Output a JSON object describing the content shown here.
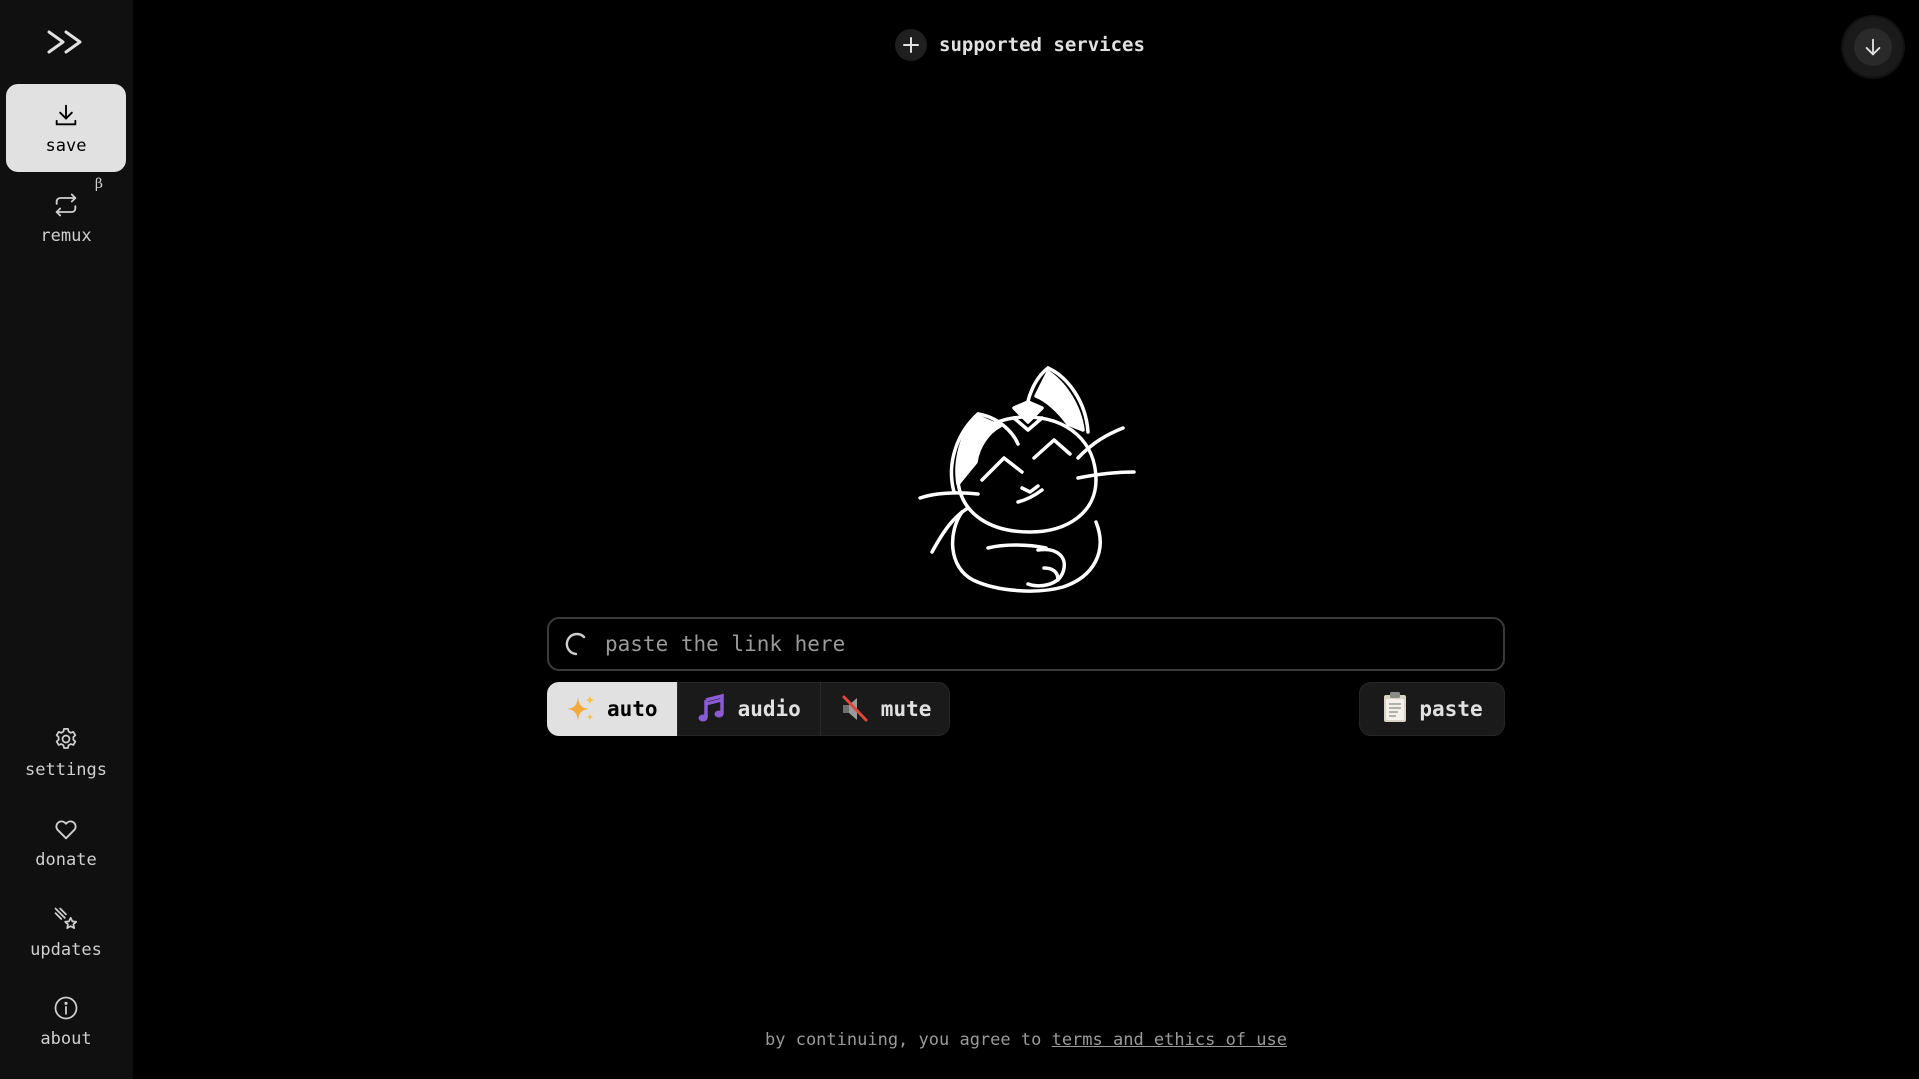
{
  "sidebar": {
    "top_items": [
      {
        "label": "save",
        "icon": "download-icon",
        "active": true
      },
      {
        "label": "remux",
        "icon": "repeat-icon",
        "badge": "β",
        "active": false
      }
    ],
    "bottom_items": [
      {
        "label": "settings",
        "icon": "gear-icon"
      },
      {
        "label": "donate",
        "icon": "heart-icon"
      },
      {
        "label": "updates",
        "icon": "sparkle-star-icon"
      },
      {
        "label": "about",
        "icon": "info-icon"
      }
    ]
  },
  "header": {
    "supported_label": "supported services"
  },
  "input": {
    "placeholder": "paste the link here",
    "value": ""
  },
  "modes": [
    {
      "label": "auto",
      "icon": "sparkles-icon",
      "active": true
    },
    {
      "label": "audio",
      "icon": "music-notes-icon",
      "active": false
    },
    {
      "label": "mute",
      "icon": "muted-speaker-icon",
      "active": false
    }
  ],
  "paste_label": "paste",
  "footer": {
    "prefix": "by continuing, you agree to ",
    "link": "terms and ethics of use"
  },
  "colors": {
    "background": "#000000",
    "sidebar": "#101010",
    "active": "#e1e1e1",
    "text": "#e1e1e1",
    "muted": "#9a9a9a"
  }
}
